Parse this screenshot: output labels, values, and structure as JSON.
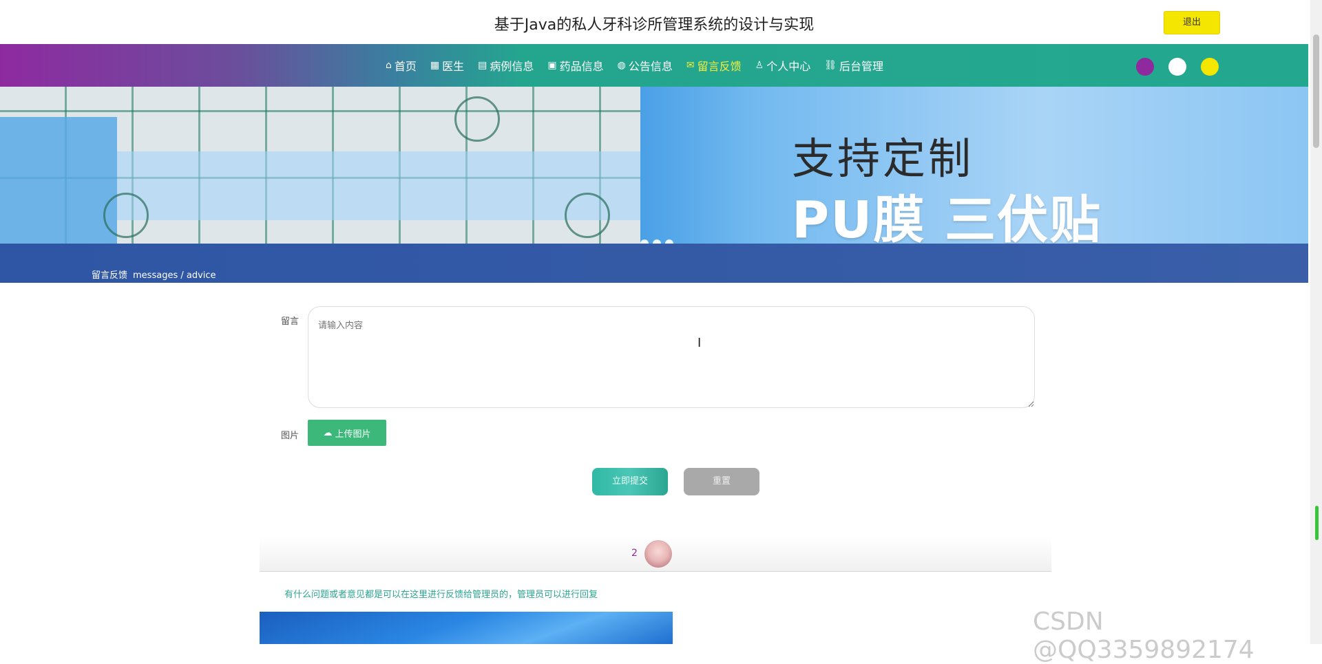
{
  "header": {
    "site_title": "基于Java的私人牙科诊所管理系统的设计与实现",
    "logout_label": "退出"
  },
  "nav": {
    "items": [
      {
        "icon": "home-icon",
        "glyph": "⌂",
        "label": "首页"
      },
      {
        "icon": "doctor-icon",
        "glyph": "▦",
        "label": "医生"
      },
      {
        "icon": "book-icon",
        "glyph": "▤",
        "label": "病例信息"
      },
      {
        "icon": "gift-icon",
        "glyph": "▣",
        "label": "药品信息"
      },
      {
        "icon": "globe-icon",
        "glyph": "◍",
        "label": "公告信息"
      },
      {
        "icon": "mail-icon",
        "glyph": "✉",
        "label": "留言反馈",
        "active": true
      },
      {
        "icon": "user-icon",
        "glyph": "♙",
        "label": "个人中心"
      },
      {
        "icon": "link-icon",
        "glyph": "⛓",
        "label": "后台管理"
      }
    ],
    "theme_colors": [
      "#8f2a9e",
      "#ffffff",
      "#f5e600"
    ],
    "accent_active": "#f5ef3a"
  },
  "banner": {
    "line1": "支持定制",
    "line2": "PU膜 三伏贴"
  },
  "breadcrumb": {
    "cn": "留言反馈",
    "en": "messages / advice"
  },
  "form": {
    "message_label": "留言",
    "message_placeholder": "请输入内容",
    "image_label": "图片",
    "upload_label": "上传图片",
    "submit_label": "立即提交",
    "reset_label": "重置"
  },
  "messages": [
    {
      "user": "2",
      "text": "有什么问题或者意见都是可以在这里进行反馈给管理员的，管理员可以进行回复"
    }
  ],
  "watermark": "CSDN @QQ3359892174"
}
